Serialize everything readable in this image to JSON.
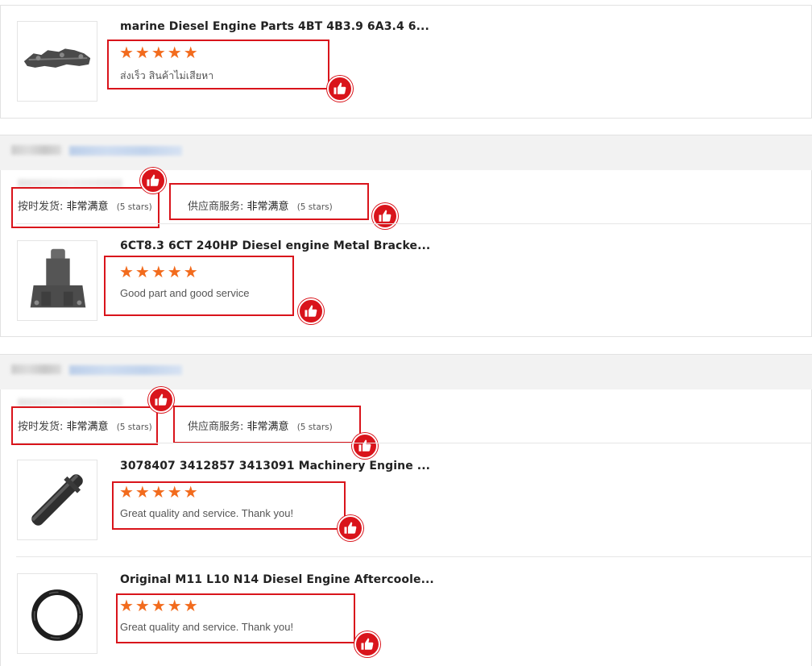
{
  "products": [
    {
      "title": "marine Diesel Engine Parts 4BT 4B3.9 6A3.4 6...",
      "stars": "★★★★★",
      "review": "ส่งเร็ว สินค้าไม่เสียหา",
      "image_icon": "engine-bracket-image"
    },
    {
      "title": "6CT8.3 6CT 240HP Diesel engine Metal Bracke...",
      "stars": "★★★★★",
      "review": "Good part and good service",
      "image_icon": "metal-bracket-image"
    },
    {
      "title": "3078407 3412857 3413091 Machinery Engine ...",
      "stars": "★★★★★",
      "review": "Great quality and service. Thank you!",
      "image_icon": "cylinder-pin-image"
    },
    {
      "title": "Original M11 L10 N14 Diesel Engine Aftercoole...",
      "stars": "★★★★★",
      "review": "Great quality and service. Thank you!",
      "image_icon": "o-ring-image"
    }
  ],
  "supplier_ratings": [
    {
      "delivery_label": "按时发货:",
      "delivery_value": "非常满意",
      "delivery_count": "(5 stars)",
      "service_label": "供应商服务:",
      "service_value": "非常满意",
      "service_count": "(5 stars)"
    },
    {
      "delivery_label": "按时发货:",
      "delivery_value": "非常满意",
      "delivery_count": "(5 stars)",
      "service_label": "供应商服务:",
      "service_value": "非常满意",
      "service_count": "(5 stars)"
    }
  ],
  "colors": {
    "star": "#f26b1d",
    "highlight": "#d9141b",
    "band": "#f2f2f2"
  },
  "icons": {
    "thumbs_up": "thumbs-up-icon"
  }
}
